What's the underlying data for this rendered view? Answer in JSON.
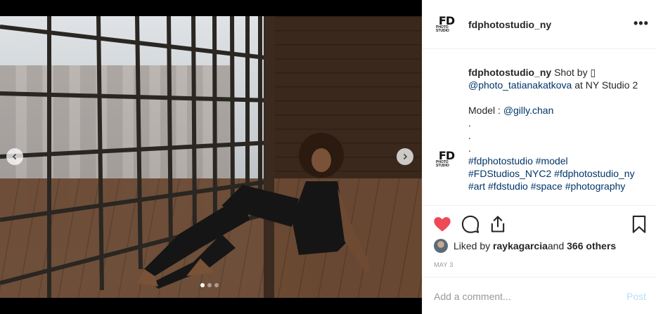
{
  "header": {
    "logo_text": "FD",
    "logo_sub": "PHOTO STUDIO",
    "username": "fdphotostudio_ny",
    "more_label": "•••"
  },
  "carousel": {
    "slide_count": 3,
    "active_index": 0
  },
  "caption": {
    "username": "fdphotostudio_ny",
    "text_1": " Shot by ",
    "emoji_placeholder": "▯",
    "mention_1": "@photo_tatianakatkova",
    "text_2": " at NY Studio 2",
    "model_label": "Model : ",
    "mention_2": "@gilly.chan",
    "dot": ".",
    "hashtags_line_1": "#fdphotostudio #model",
    "hashtags_line_2": "#FDStudios_NYC2 #fdphotostudio_ny",
    "hashtags_line_3": "#art #fdstudio #space #photography"
  },
  "likes": {
    "prefix": "Liked by ",
    "user": "raykagarcia",
    "suffix": " and ",
    "others": "366 others"
  },
  "date": "MAY 3",
  "comment": {
    "placeholder": "Add a comment...",
    "post_label": "Post"
  },
  "colors": {
    "heart": "#ed4956",
    "link": "#003569",
    "post_disabled": "#b2dffc"
  }
}
